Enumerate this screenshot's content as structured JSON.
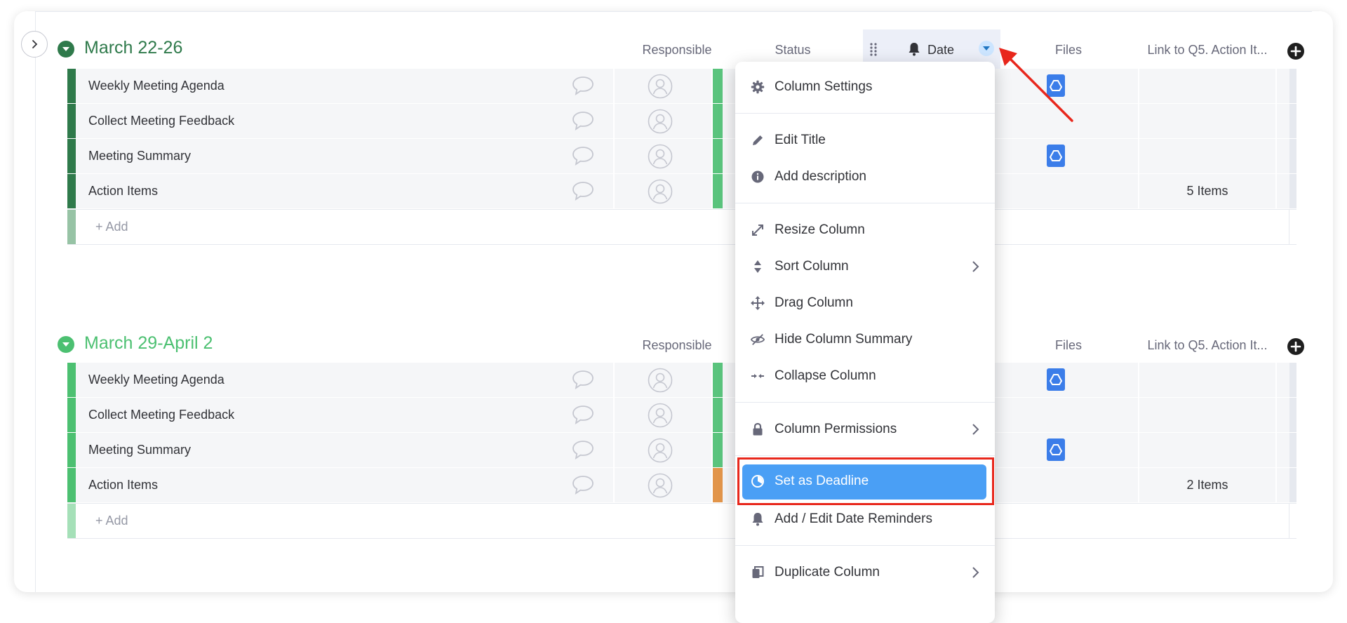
{
  "groups": [
    {
      "title": "March 22-26",
      "color": "#2f7a4b",
      "add_label": "+ Add",
      "rows": [
        {
          "name": "Weekly Meeting Agenda",
          "status_color": "#5ac47d",
          "has_file": true,
          "link": ""
        },
        {
          "name": "Collect Meeting Feedback",
          "status_color": "#5ac47d",
          "has_file": false,
          "link": ""
        },
        {
          "name": "Meeting Summary",
          "status_color": "#5ac47d",
          "has_file": true,
          "link": ""
        },
        {
          "name": "Action Items",
          "status_color": "#5ac47d",
          "has_file": false,
          "link": "5 Items"
        }
      ]
    },
    {
      "title": "March 29-April 2",
      "color": "#4cc071",
      "add_label": "+ Add",
      "rows": [
        {
          "name": "Weekly Meeting Agenda",
          "status_color": "#5ac47d",
          "has_file": true,
          "link": ""
        },
        {
          "name": "Collect Meeting Feedback",
          "status_color": "#5ac47d",
          "has_file": false,
          "link": ""
        },
        {
          "name": "Meeting Summary",
          "status_color": "#5ac47d",
          "has_file": true,
          "link": ""
        },
        {
          "name": "Action Items",
          "status_color": "#e2954a",
          "has_file": false,
          "link": "2 Items"
        }
      ]
    }
  ],
  "columns": {
    "responsible": "Responsible",
    "status": "Status",
    "date": "Date",
    "files": "Files",
    "link": "Link to Q5. Action It..."
  },
  "menu": {
    "column_settings": "Column Settings",
    "edit_title": "Edit Title",
    "add_description": "Add description",
    "resize_column": "Resize Column",
    "sort_column": "Sort Column",
    "drag_column": "Drag Column",
    "hide_column_summary": "Hide Column Summary",
    "collapse_column": "Collapse Column",
    "column_permissions": "Column Permissions",
    "set_as_deadline": "Set as Deadline",
    "add_edit_date_reminders": "Add / Edit Date Reminders",
    "duplicate_column": "Duplicate Column"
  },
  "colors": {
    "highlight": "#4a9ff5",
    "annotation": "#e8271c",
    "file_icon": "#3b7de9"
  }
}
